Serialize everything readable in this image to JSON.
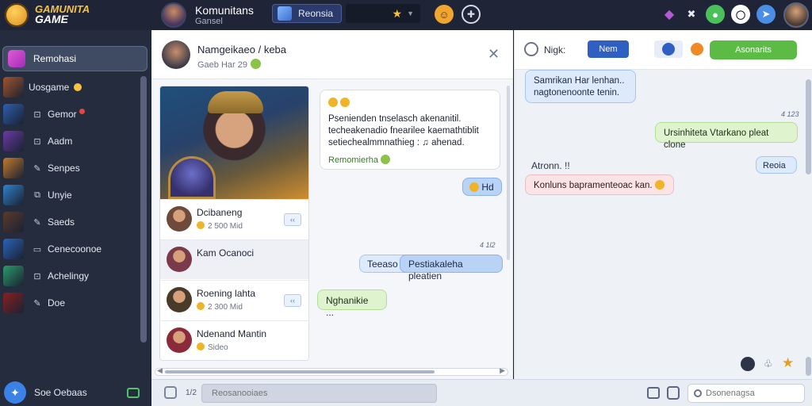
{
  "app": {
    "logo_line1": "GAMUNITA",
    "logo_line2": "GAME",
    "title": "Komunitans",
    "subtitle": "Gansel",
    "tab_label": "Reonsia"
  },
  "sidebar": {
    "active_label": "Remohasi",
    "items": [
      {
        "label": "Uosgame",
        "glyph": "",
        "badge": "yellow",
        "thumb": "#a2552c"
      },
      {
        "label": "Gemor",
        "glyph": "⊡",
        "badge": "red",
        "thumb": "#2d5fb0"
      },
      {
        "label": "Aadm",
        "glyph": "⊡",
        "badge": "",
        "thumb": "#6a3aa6"
      },
      {
        "label": "Senpes",
        "glyph": "✎",
        "badge": "",
        "thumb": "#c27a2a"
      },
      {
        "label": "Unyie",
        "glyph": "⧉",
        "badge": "",
        "thumb": "#2e83c9"
      },
      {
        "label": "Saeds",
        "glyph": "✎",
        "badge": "",
        "thumb": "#5a3a2a"
      },
      {
        "label": "Cenecoonoe",
        "glyph": "▭",
        "badge": "",
        "thumb": "#2a64b8"
      },
      {
        "label": "Achelingy",
        "glyph": "⊡",
        "badge": "",
        "thumb": "#2a9a6a"
      },
      {
        "label": "Doe",
        "glyph": "✎",
        "badge": "",
        "thumb": "#8a1f1f"
      }
    ],
    "bottom_label": "Soe Oebaas"
  },
  "chat": {
    "header_name": "Namgeikaeo / keba",
    "header_sub": "Gaeb  Har 29",
    "card_rows": [
      {
        "name": "Dcibaneng",
        "meta": "2 500 Mid",
        "has_button": true,
        "button": "‹‹",
        "color": "#6d4a3a"
      },
      {
        "name": "Kam Ocanoci",
        "meta": "",
        "has_button": false,
        "button": "",
        "color": "#7a3a4a"
      },
      {
        "name": "Roening lahta",
        "meta": "2 300 Mid",
        "has_button": true,
        "button": "‹‹",
        "color": "#4a3a2a"
      },
      {
        "name": "Ndenand Mantin",
        "meta": "Sideo",
        "has_button": false,
        "button": "",
        "color": "#8a2a3a"
      }
    ],
    "messages": {
      "incoming_text": "Psenienden tnselasch akenanitil. techeakenadio fnearilee kaemathtiblit setiechealmmnathieg : ♫ ahenad.",
      "incoming_tag": "Remomierha",
      "reply_small": "Hd",
      "timestamp1": "4 1l2",
      "out_light": "Teeaso",
      "out_blue": "Pestiakaleha pleatien",
      "incoming_green": "Nghanikie ..."
    }
  },
  "right_panel": {
    "label": "Nigk:",
    "tab_label": "Nem",
    "button_label": "Asonarits",
    "messages": {
      "in1": "Samrikan Har lenhan.. nagtonenoonte tenin.",
      "timestamp": "4 123",
      "out_green": "Ursinhiteta Vtarkano pleat clone",
      "author": "Atronn. !!",
      "reply": "Reoia",
      "pink": "Konluns bapramenteoac kan."
    }
  },
  "inputbar": {
    "count": "1/2",
    "message_placeholder": "Reosanooiaes",
    "search_placeholder": "Dsonenagsa"
  }
}
